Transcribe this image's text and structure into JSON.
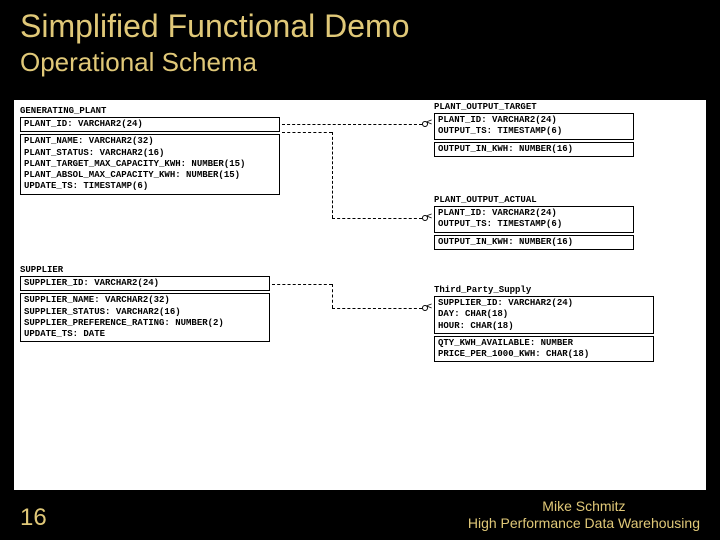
{
  "title": "Simplified Functional Demo",
  "subtitle": "Operational Schema",
  "slide_number": "16",
  "credit_line1": "Mike Schmitz",
  "credit_line2": "High Performance Data Warehousing",
  "entities": {
    "generating_plant": {
      "name": "GENERATING_PLANT",
      "pk": "PLANT_ID: VARCHAR2(24)",
      "attrs": [
        "PLANT_NAME: VARCHAR2(32)",
        "PLANT_STATUS: VARCHAR2(16)",
        "PLANT_TARGET_MAX_CAPACITY_KWH: NUMBER(15)",
        "PLANT_ABSOL_MAX_CAPACITY_KWH: NUMBER(15)",
        "UPDATE_TS: TIMESTAMP(6)"
      ]
    },
    "supplier": {
      "name": "SUPPLIER",
      "pk": "SUPPLIER_ID: VARCHAR2(24)",
      "attrs": [
        "SUPPLIER_NAME: VARCHAR2(32)",
        "SUPPLIER_STATUS: VARCHAR2(16)",
        "SUPPLIER_PREFERENCE_RATING: NUMBER(2)",
        "UPDATE_TS: DATE"
      ]
    },
    "plant_output_target": {
      "name": "PLANT_OUTPUT_TARGET",
      "pk": [
        "PLANT_ID: VARCHAR2(24)",
        "OUTPUT_TS: TIMESTAMP(6)"
      ],
      "attrs": [
        "OUTPUT_IN_KWH: NUMBER(16)"
      ]
    },
    "plant_output_actual": {
      "name": "PLANT_OUTPUT_ACTUAL",
      "pk": [
        "PLANT_ID: VARCHAR2(24)",
        "OUTPUT_TS: TIMESTAMP(6)"
      ],
      "attrs": [
        "OUTPUT_IN_KWH: NUMBER(16)"
      ]
    },
    "third_party_supply": {
      "name": "Third_Party_Supply",
      "pk": [
        "SUPPLIER_ID: VARCHAR2(24)",
        "DAY: CHAR(18)",
        "HOUR: CHAR(18)"
      ],
      "attrs": [
        "QTY_KWH_AVAILABLE: NUMBER",
        "PRICE_PER_1000_KWH: CHAR(18)"
      ]
    }
  }
}
